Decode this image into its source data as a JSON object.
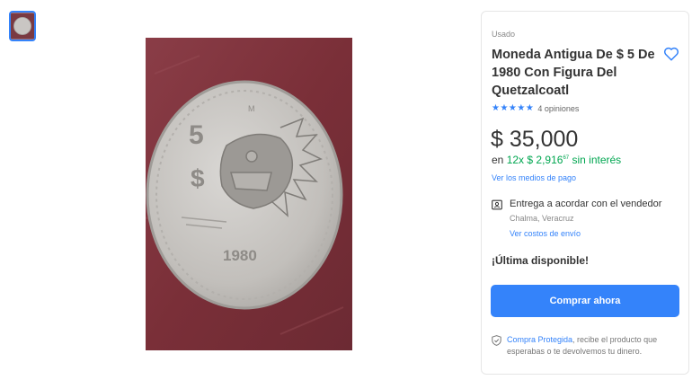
{
  "gallery": {
    "thumbnail_icon": "coin-photo-thumbnail",
    "image_icon": "coin-photo-quetzalcoatl",
    "coin_denomination": "5",
    "coin_currency": "$",
    "coin_mint": "M",
    "coin_year": "1980"
  },
  "product": {
    "condition": "Usado",
    "title": "Moneda Antigua De $ 5 De 1980 Con Figura Del Quetzalcoatl",
    "favorite_icon": "heart-icon",
    "rating_stars": "★★★★★",
    "reviews_label": "4 opiniones",
    "price": "$ 35,000",
    "installments_prefix": "en",
    "installments_count": "12x",
    "installments_amount": "$ 2,916",
    "installments_cents": "67",
    "installments_suffix": "sin interés",
    "payment_methods_link": "Ver los medios de pago"
  },
  "shipping": {
    "icon": "id-card-icon",
    "title": "Entrega a acordar con el vendedor",
    "location": "Chalma, Veracruz",
    "costs_link": "Ver costos de envío"
  },
  "stock": {
    "label": "¡Última disponible!"
  },
  "buy_button": {
    "label": "Comprar ahora"
  },
  "protection": {
    "icon": "shield-check-icon",
    "link": "Compra Protegida",
    "text": ", recibe el producto que esperabas o te devolvemos tu dinero."
  },
  "colors": {
    "accent": "#3483fa",
    "green": "#00a650",
    "background_red": "#7a2f38"
  }
}
